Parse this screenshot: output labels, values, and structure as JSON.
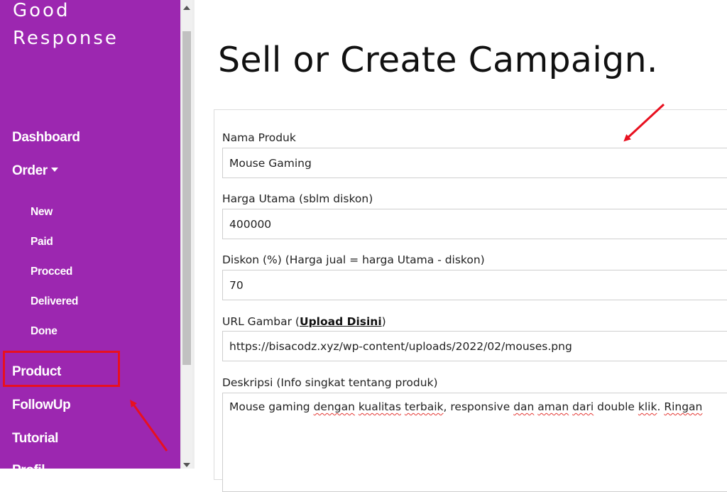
{
  "sidebar": {
    "brand_line1": "Good",
    "brand_line2": "Response",
    "nav": {
      "dashboard": "Dashboard",
      "order": "Order",
      "product": "Product",
      "followup": "FollowUp",
      "tutorial": "Tutorial",
      "profile": "Profil"
    },
    "order_sub": {
      "new": "New",
      "paid": "Paid",
      "procced": "Procced",
      "delivered": "Delivered",
      "done": "Done"
    }
  },
  "main": {
    "title": "Sell or Create Campaign.",
    "fields": {
      "nama_label": "Nama Produk",
      "nama_value": "Mouse Gaming",
      "harga_label": "Harga Utama (sblm diskon)",
      "harga_value": "400000",
      "diskon_label": "Diskon (%) (Harga jual = harga Utama - diskon)",
      "diskon_value": "70",
      "url_label_prefix": "URL Gambar (",
      "url_label_link": "Upload Disini",
      "url_label_suffix": ")",
      "url_value": "https://bisacodz.xyz/wp-content/uploads/2022/02/mouses.png",
      "deskripsi_label": "Deskripsi (Info singkat tentang produk)",
      "deskripsi_words": [
        "Mouse gaming ",
        "dengan",
        " ",
        "kualitas",
        " ",
        "terbaik",
        ", responsive ",
        "dan",
        " ",
        "aman",
        " ",
        "dari",
        " double ",
        "klik",
        ". ",
        "Ringan"
      ]
    }
  },
  "colors": {
    "sidebar_bg": "#9c27b0",
    "annotation_red": "#e8101f"
  },
  "icons": {
    "order_caret": "caret-down-icon",
    "scroll_up": "scroll-up-arrow-icon",
    "scroll_down": "scroll-down-arrow-icon"
  }
}
